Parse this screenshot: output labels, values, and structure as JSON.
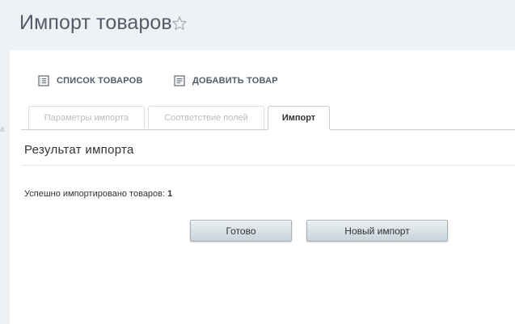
{
  "header": {
    "title": "Импорт товаров",
    "favorite_icon": "star-outline-icon"
  },
  "sidebar_hint": {
    "text": "а"
  },
  "toolbar": {
    "product_list_label": "СПИСОК ТОВАРОВ",
    "product_list_icon": "list-icon",
    "add_product_label": "ДОБАВИТЬ ТОВАР",
    "add_product_icon": "form-icon"
  },
  "tabs": [
    {
      "label": "Параметры импорта",
      "active": false
    },
    {
      "label": "Соответствие полей",
      "active": false
    },
    {
      "label": "Импорт",
      "active": true
    }
  ],
  "result": {
    "title": "Результат импорта",
    "imported_label": "Успешно импортировано товаров:",
    "imported_count": "1"
  },
  "actions": {
    "done_label": "Готово",
    "new_import_label": "Новый импорт"
  },
  "colors": {
    "page_background": "#eef2f4",
    "panel_background": "#ffffff",
    "title_text": "#535c69",
    "button_gradient_top": "#eaf0f3",
    "button_gradient_bottom": "#c9d3d9"
  }
}
